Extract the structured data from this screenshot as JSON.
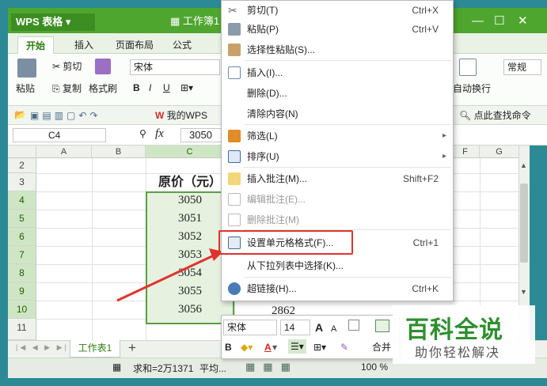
{
  "app": {
    "logo": "WPS 表格",
    "doc_title": "工作簿1",
    "win_min": "—",
    "win_max": "☐",
    "win_close": "✕"
  },
  "tabs": [
    "开始",
    "插入",
    "页面布局",
    "公式"
  ],
  "ribbon": {
    "paste": "粘贴",
    "cut": "剪切",
    "copy": "复制",
    "format_painter": "格式刷",
    "font_name": "宋体",
    "bold": "B",
    "italic": "I",
    "underline": "U",
    "wrap_text": "自动换行",
    "number_format": "常规"
  },
  "quick": {
    "my_wps": "我的WPS",
    "find": "点此查找命令"
  },
  "formula_bar": {
    "name_box": "C4",
    "fx": "fx",
    "value": "3050"
  },
  "columns": [
    "A",
    "B",
    "C",
    "F",
    "G"
  ],
  "rows": [
    "2",
    "3",
    "4",
    "5",
    "6",
    "7",
    "8",
    "9",
    "10",
    "11"
  ],
  "cells": {
    "header": "原价（元）",
    "values": [
      "3050",
      "3051",
      "3052",
      "3053",
      "3054",
      "3055",
      "3056"
    ],
    "d10": "2862"
  },
  "sheet": {
    "tab": "工作表1",
    "add": "+"
  },
  "status": {
    "sum": "求和=2万1371",
    "avg": "平均...",
    "zoom": "100 %"
  },
  "context_menu": {
    "items": [
      {
        "label": "剪切(T)",
        "shortcut": "Ctrl+X",
        "icon": "scissors-icon"
      },
      {
        "label": "粘贴(P)",
        "shortcut": "Ctrl+V",
        "icon": "paste-icon"
      },
      {
        "label": "选择性粘贴(S)...",
        "shortcut": "",
        "icon": "paste-special-icon"
      },
      {
        "label": "插入(I)...",
        "shortcut": "",
        "icon": "insert-icon"
      },
      {
        "label": "删除(D)...",
        "shortcut": "",
        "icon": ""
      },
      {
        "label": "清除内容(N)",
        "shortcut": "",
        "icon": ""
      },
      {
        "label": "筛选(L)",
        "shortcut": "",
        "icon": "filter-icon"
      },
      {
        "label": "排序(U)",
        "shortcut": "",
        "icon": "sort-icon"
      },
      {
        "label": "插入批注(M)...",
        "shortcut": "Shift+F2",
        "icon": "comment-add-icon"
      },
      {
        "label": "编辑批注(E)...",
        "shortcut": "",
        "icon": "comment-edit-icon"
      },
      {
        "label": "删除批注(M)",
        "shortcut": "",
        "icon": "comment-delete-icon"
      },
      {
        "label": "设置单元格格式(F)...",
        "shortcut": "Ctrl+1",
        "icon": "format-cells-icon"
      },
      {
        "label": "从下拉列表中选择(K)...",
        "shortcut": "",
        "icon": ""
      },
      {
        "label": "超链接(H)...",
        "shortcut": "Ctrl+K",
        "icon": "hyperlink-icon"
      }
    ]
  },
  "mini_toolbar": {
    "font": "宋体",
    "size": "14",
    "grow": "A",
    "shrink": "A",
    "bold": "B",
    "font_color": "A",
    "merge": "合并"
  },
  "watermark": {
    "title": "百科全说",
    "subtitle": "助你轻松解决"
  },
  "colors": {
    "accent": "#4fa62f",
    "highlight": "#e0332e",
    "selection": "#e6f2df"
  }
}
